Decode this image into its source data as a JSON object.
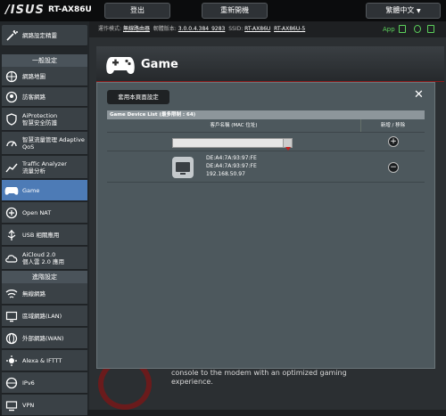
{
  "header": {
    "logo": "/ISUS",
    "model": "RT-AX86U",
    "logout": "登出",
    "reboot": "重新開機",
    "language": "繁體中文"
  },
  "info_bar": {
    "mode_label": "運作模式:",
    "mode_value": "無線路由器",
    "firmware_label": "韌體版本:",
    "firmware_value": "3.0.0.4.384_9283",
    "ssid_label": "SSID:",
    "ssid_1": "RT-AX86U",
    "ssid_2": "RT-AX86U-5",
    "app": "App"
  },
  "sidebar": {
    "quick_setup": "網路設定精靈",
    "general_header": "一般設定",
    "general_items": [
      {
        "label": "網路地圖"
      },
      {
        "label": "訪客網路"
      },
      {
        "label": "AiProtection\n智慧安全防護"
      },
      {
        "label": "智慧流量管理 Adaptive\nQoS"
      },
      {
        "label": "Traffic Analyzer\n流量分析"
      },
      {
        "label": "Game"
      },
      {
        "label": "Open NAT"
      },
      {
        "label": "USB 相關應用"
      },
      {
        "label": "AiCloud 2.0\n個人雲 2.0 應用"
      }
    ],
    "advanced_header": "進階設定",
    "advanced_items": [
      {
        "label": "無線網路"
      },
      {
        "label": "區域網路(LAN)"
      },
      {
        "label": "外部網路(WAN)"
      },
      {
        "label": "Alexa & IFTTT"
      },
      {
        "label": "IPv6"
      },
      {
        "label": "VPN"
      }
    ]
  },
  "page": {
    "title": "Game",
    "background_text": "console to the modem with an optimized gaming experience."
  },
  "dialog": {
    "apply_button": "套用本頁面設定",
    "close": "✕",
    "list_header": "Game Device List (最多限制 : 64)",
    "col_client": "客戶名稱 (MAC 位址)",
    "col_action": "新增 / 移除",
    "add_symbol": "+",
    "remove_symbol": "−",
    "device": {
      "name": "DE:A4:7A:93:97:FE",
      "mac": "DE:A4:7A:93:97:FE",
      "ip": "192.168.50.97"
    }
  },
  "colors": {
    "active_nav": "#4d7bb6",
    "status_green": "#5cd25c",
    "accent_red": "#c81e1e"
  }
}
